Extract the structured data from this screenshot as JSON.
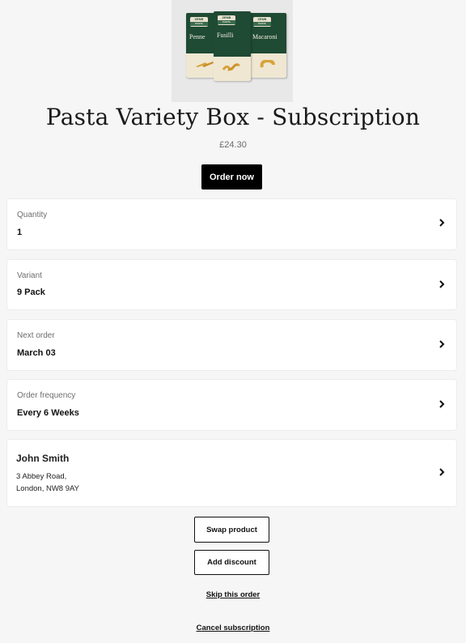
{
  "product": {
    "image": {
      "brand_text": "ZENB",
      "brand_sub": "PASTA",
      "boxes": [
        "Penne",
        "Fusilli",
        "Macaroni"
      ],
      "colors": {
        "box": "#1f4a34",
        "label": "#efe7d2",
        "pasta": "#d9a33a"
      }
    },
    "title": "Pasta Variety Box - Subscription",
    "price": "£24.30",
    "order_button": "Order now"
  },
  "cards": {
    "quantity": {
      "label": "Quantity",
      "value": "1"
    },
    "variant": {
      "label": "Variant",
      "value": "9 Pack"
    },
    "next_order": {
      "label": "Next order",
      "value": "March 03"
    },
    "frequency": {
      "label": "Order frequency",
      "value": "Every 6 Weeks"
    },
    "address": {
      "name": "John Smith",
      "line1": "3 Abbey Road,",
      "line2": "London, NW8 9AY"
    }
  },
  "actions": {
    "swap": "Swap product",
    "discount": "Add discount",
    "skip": "Skip this order",
    "cancel": "Cancel subscription"
  },
  "icons": {
    "chevron": "chevron-right-icon"
  }
}
